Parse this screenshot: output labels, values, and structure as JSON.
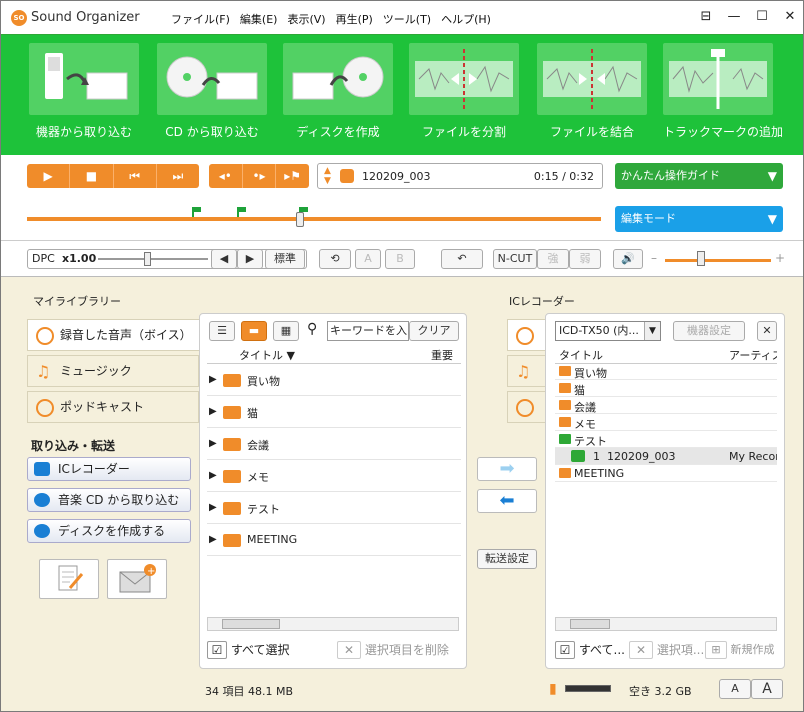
{
  "app": {
    "title": "Sound Organizer"
  },
  "menu": [
    "ファイル(F)",
    "編集(E)",
    "表示(V)",
    "再生(P)",
    "ツール(T)",
    "ヘルプ(H)"
  ],
  "toolbar": [
    "機器から取り込む",
    "CD から取り込む",
    "ディスクを作成",
    "ファイルを分割",
    "ファイルを結合",
    "トラックマークの追加"
  ],
  "player": {
    "track": "120209_003",
    "time": "0:15 / 0:32",
    "guide": "かんたん操作ガイド",
    "mode": "編集モード",
    "progress": 0.47
  },
  "dpc": {
    "label": "DPC",
    "value": "x1.00",
    "standard": "標準",
    "ncut": "N-CUT",
    "strong": "強",
    "weak": "弱",
    "btn_a": "A",
    "btn_b": "B"
  },
  "library": {
    "title": "マイライブラリー",
    "tabs": [
      "録音した音声（ボイス）",
      "ミュージック",
      "ポッドキャスト"
    ],
    "import_title": "取り込み・転送",
    "import_btns": [
      "ICレコーダー",
      "音楽 CD から取り込む",
      "ディスクを作成する"
    ]
  },
  "list": {
    "search_placeholder": "キーワードを入...",
    "clear": "クリア",
    "col_title": "タイトル ▼",
    "col_important": "重要",
    "folders": [
      "買い物",
      "猫",
      "会議",
      "メモ",
      "テスト",
      "MEETING"
    ],
    "select_all": "すべて選択",
    "delete_selected": "選択項目を削除",
    "status": "34 項目 48.1 MB"
  },
  "transfer": {
    "settings": "転送設定"
  },
  "icr": {
    "title": "ICレコーダー",
    "device": "ICD-TX50 (内...",
    "device_settings": "機器設定",
    "col_title": "タイトル",
    "col_artist": "アーティスト",
    "folders": [
      "買い物",
      "猫",
      "会議",
      "メモ",
      "テスト"
    ],
    "file_num": "1",
    "file_name": "120209_003",
    "file_artist": "My Recor",
    "folder_last": "MEETING",
    "select_all": "すべて...",
    "delete_selected": "選択項...",
    "new_folder": "新規作成",
    "free_space": "空き 3.2 GB",
    "font_small": "A",
    "font_large": "A"
  }
}
